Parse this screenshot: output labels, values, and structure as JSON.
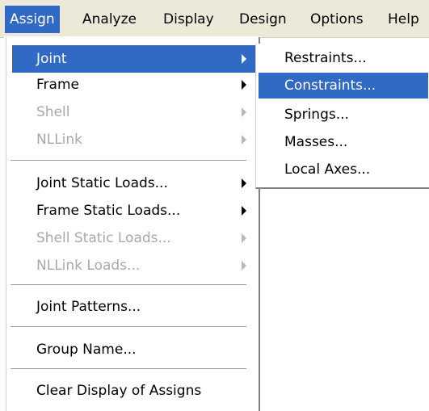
{
  "menubar": {
    "items": [
      {
        "label": "Assign",
        "active": true
      },
      {
        "label": "Analyze"
      },
      {
        "label": "Display"
      },
      {
        "label": "Design"
      },
      {
        "label": "Options"
      },
      {
        "label": "Help"
      }
    ]
  },
  "assign_menu": {
    "items": [
      {
        "label": "Joint",
        "submenu": true,
        "highlighted": true,
        "enabled": true
      },
      {
        "label": "Frame",
        "submenu": true,
        "enabled": true
      },
      {
        "label": "Shell",
        "submenu": true,
        "enabled": false
      },
      {
        "label": "NLLink",
        "submenu": true,
        "enabled": false
      },
      {
        "label": "Joint Static Loads...",
        "submenu": true,
        "enabled": true
      },
      {
        "label": "Frame Static Loads...",
        "submenu": true,
        "enabled": true
      },
      {
        "label": "Shell Static Loads...",
        "submenu": true,
        "enabled": false
      },
      {
        "label": "NLLink Loads...",
        "submenu": true,
        "enabled": false
      },
      {
        "label": "Joint Patterns...",
        "enabled": true
      },
      {
        "label": "Group Name...",
        "enabled": true
      },
      {
        "label": "Clear Display of Assigns",
        "enabled": true
      }
    ]
  },
  "joint_submenu": {
    "items": [
      {
        "label": "Restraints..."
      },
      {
        "label": "Constraints...",
        "highlighted": true
      },
      {
        "label": "Springs..."
      },
      {
        "label": "Masses..."
      },
      {
        "label": "Local Axes..."
      }
    ]
  },
  "colors": {
    "highlight": "#316ac5",
    "menubar": "#ece9d8",
    "disabled_text": "#a8a8a8"
  }
}
